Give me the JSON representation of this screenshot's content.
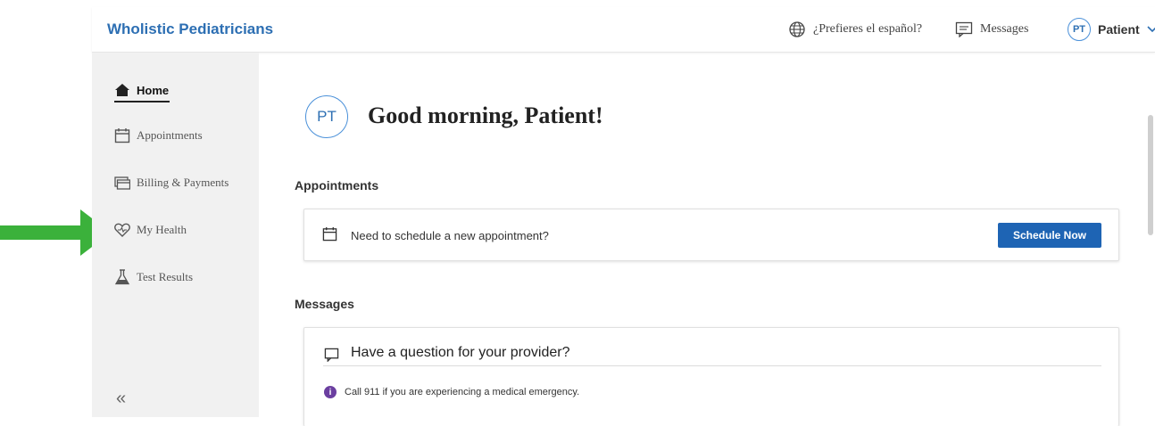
{
  "header": {
    "brand": "Wholistic Pediatricians",
    "language_link": "¿Prefieres el español?",
    "messages_label": "Messages",
    "user_initials": "PT",
    "user_name": "Patient"
  },
  "sidebar": {
    "items": [
      {
        "label": "Home",
        "icon": "home-icon",
        "active": true
      },
      {
        "label": "Appointments",
        "icon": "calendar-icon"
      },
      {
        "label": "Billing & Payments",
        "icon": "billing-icon"
      },
      {
        "label": "My Health",
        "icon": "heart-icon"
      },
      {
        "label": "Test Results",
        "icon": "flask-icon"
      }
    ],
    "collapse_glyph": "«"
  },
  "main": {
    "avatar_initials": "PT",
    "greeting": "Good morning, Patient!",
    "appointments": {
      "title": "Appointments",
      "prompt": "Need to schedule a new appointment?",
      "button": "Schedule Now"
    },
    "messages": {
      "title": "Messages",
      "question": "Have a question for your provider?",
      "info_glyph": "i",
      "notice": "Call 911 if you are experiencing a medical emergency."
    }
  },
  "colors": {
    "brand": "#2d6fb3",
    "button": "#1e64b4",
    "annotation_arrow": "#3bb13b",
    "info": "#6b3fa0"
  }
}
